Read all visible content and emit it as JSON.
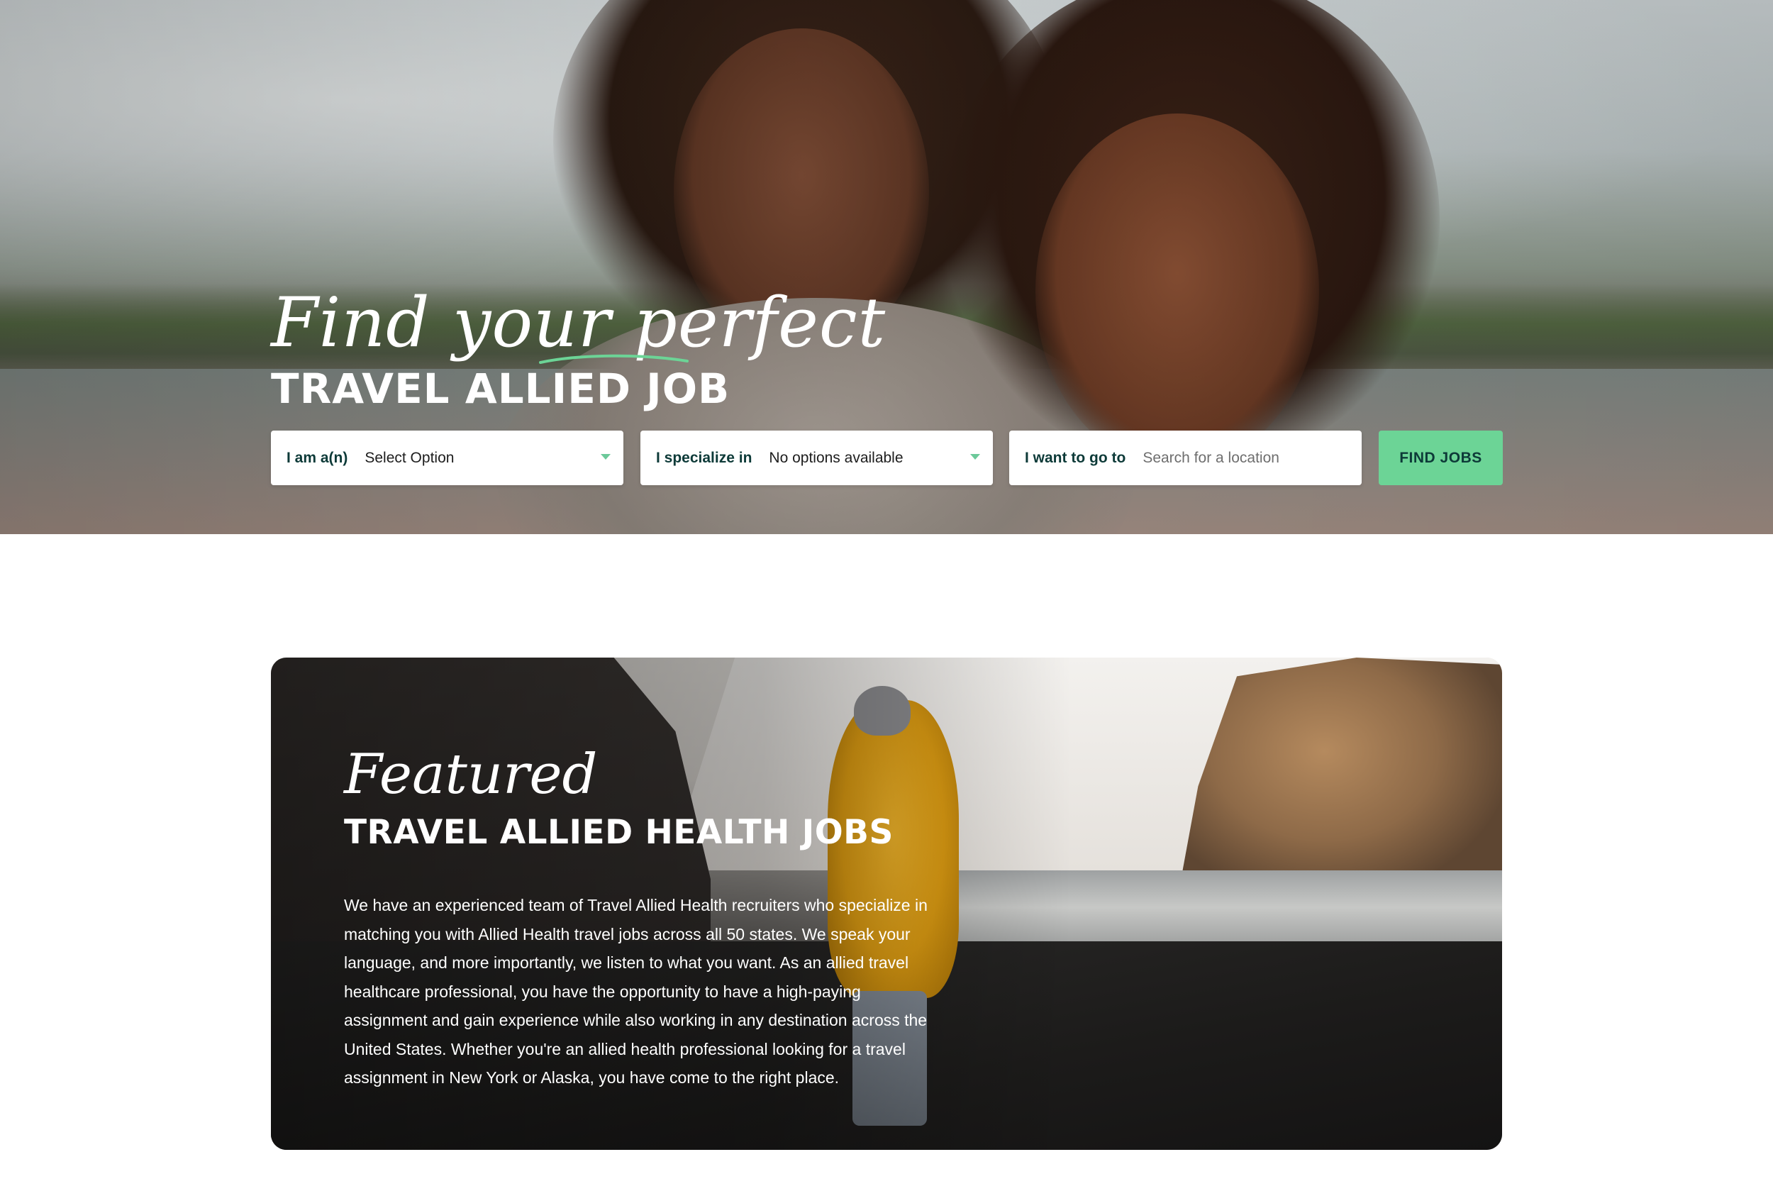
{
  "hero": {
    "script_heading": "Find your perfect",
    "title": "TRAVEL ALLIED JOB",
    "image": "two-smiling-women-beach-photo"
  },
  "search": {
    "role": {
      "label": "I am a(n)",
      "value": "Select Option",
      "icon": "chevron-down-icon"
    },
    "specialty": {
      "label": "I specialize in",
      "value": "No options available",
      "icon": "chevron-down-icon"
    },
    "location": {
      "label": "I want to go to",
      "placeholder": "Search for a location",
      "value": ""
    },
    "submit_label": "FIND JOBS"
  },
  "featured": {
    "script_heading": "Featured",
    "title": "TRAVEL ALLIED HEALTH JOBS",
    "body": "We have an experienced team of Travel Allied Health recruiters who specialize in matching you with Allied Health travel jobs across all 50 states. We speak your language, and more importantly, we listen to what you want. As an allied travel healthcare professional, you have the opportunity to have a high-paying assignment and gain experience while also working in any destination across the United States. Whether you're an allied health professional looking for a travel assignment in New York or Alaska, you have come to the right place.",
    "image": "person-yellow-jacket-black-sand-beach-photo"
  },
  "colors": {
    "accent_green": "#6cd496",
    "dark_teal": "#0d3a38",
    "caret_green": "#6cc99a",
    "white": "#ffffff"
  }
}
